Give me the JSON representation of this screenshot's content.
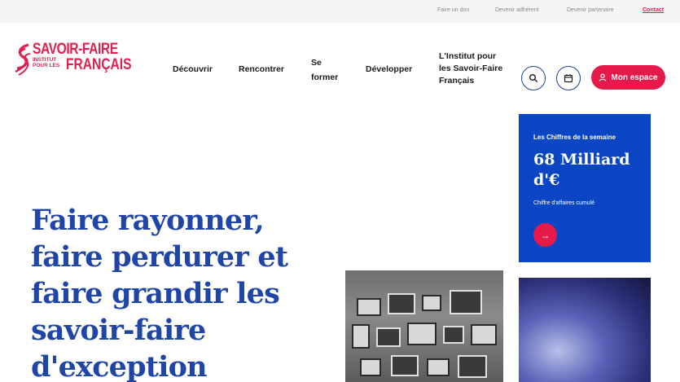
{
  "topbar": {
    "links": [
      "Faire un don",
      "Devenir adhérent",
      "Devenir partenaire"
    ],
    "contact": "Contact"
  },
  "logo": {
    "line1": "SAVOIR-FAIRE",
    "small1": "INSTITUT",
    "small2": "POUR LES",
    "line2": "FRANÇAIS"
  },
  "nav": {
    "decouvrir": "Découvrir",
    "rencontrer": "Rencontrer",
    "se_former_1": "Se",
    "se_former_2": "former",
    "developper": "Développer",
    "institut_1": "L'Institut pour",
    "institut_2": "les Savoir-Faire",
    "institut_3": "Français"
  },
  "header": {
    "mon_espace": "Mon espace",
    "icons": [
      "search-icon",
      "calendar-icon",
      "user-icon"
    ]
  },
  "hero": {
    "title_lines": [
      "Faire rayonner,",
      "faire perdurer et",
      "faire grandir les",
      "savoir-faire",
      "d'exception"
    ]
  },
  "stats": {
    "label": "Les Chiffres de la semaine",
    "value_1": "68 Milliard",
    "value_2": "d'€",
    "caption": "Chiffre d'affaires cumulé",
    "arrow": "→"
  },
  "colors": {
    "accent": "#e6194b",
    "brand_blue": "#1f46a6",
    "card_blue": "#0a46c4"
  }
}
